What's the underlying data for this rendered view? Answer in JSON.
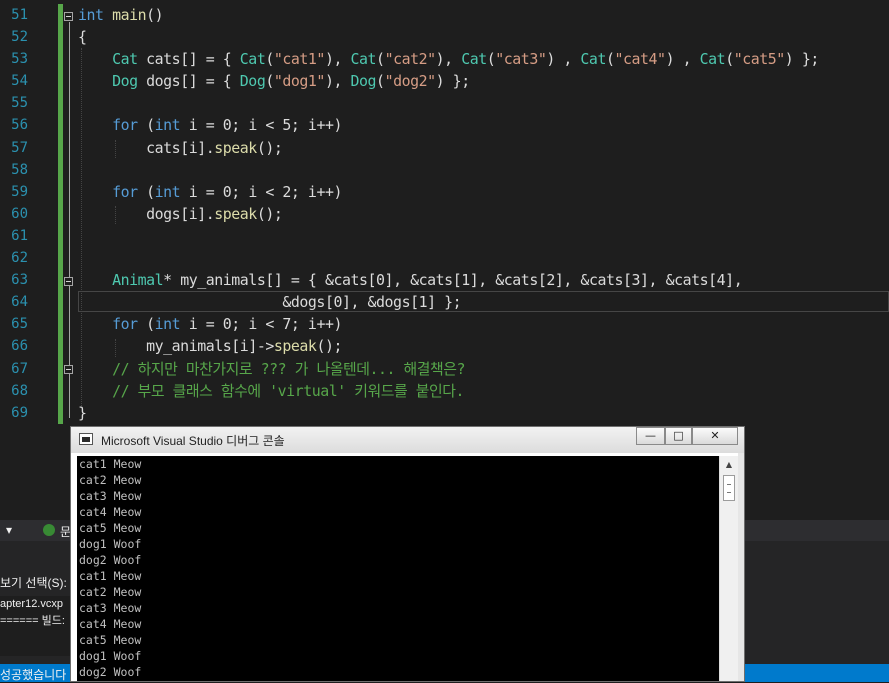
{
  "editor": {
    "line_numbers": [
      "51",
      "52",
      "53",
      "54",
      "55",
      "56",
      "57",
      "58",
      "59",
      "60",
      "61",
      "62",
      "63",
      "64",
      "65",
      "66",
      "67",
      "68",
      "69"
    ],
    "lines": [
      [
        {
          "t": "int",
          "c": "kw"
        },
        {
          "t": " ",
          "c": ""
        },
        {
          "t": "main",
          "c": "fn"
        },
        {
          "t": "()",
          "c": ""
        }
      ],
      [
        {
          "t": "{",
          "c": ""
        }
      ],
      [
        {
          "t": "    ",
          "c": ""
        },
        {
          "t": "Cat",
          "c": "ty"
        },
        {
          "t": " ",
          "c": ""
        },
        {
          "t": "cats",
          "c": "va"
        },
        {
          "t": "[] = { ",
          "c": ""
        },
        {
          "t": "Cat",
          "c": "ty"
        },
        {
          "t": "(",
          "c": ""
        },
        {
          "t": "\"cat1\"",
          "c": "st"
        },
        {
          "t": "), ",
          "c": ""
        },
        {
          "t": "Cat",
          "c": "ty"
        },
        {
          "t": "(",
          "c": ""
        },
        {
          "t": "\"cat2\"",
          "c": "st"
        },
        {
          "t": "), ",
          "c": ""
        },
        {
          "t": "Cat",
          "c": "ty"
        },
        {
          "t": "(",
          "c": ""
        },
        {
          "t": "\"cat3\"",
          "c": "st"
        },
        {
          "t": ") , ",
          "c": ""
        },
        {
          "t": "Cat",
          "c": "ty"
        },
        {
          "t": "(",
          "c": ""
        },
        {
          "t": "\"cat4\"",
          "c": "st"
        },
        {
          "t": ") , ",
          "c": ""
        },
        {
          "t": "Cat",
          "c": "ty"
        },
        {
          "t": "(",
          "c": ""
        },
        {
          "t": "\"cat5\"",
          "c": "st"
        },
        {
          "t": ") };",
          "c": ""
        }
      ],
      [
        {
          "t": "    ",
          "c": ""
        },
        {
          "t": "Dog",
          "c": "ty"
        },
        {
          "t": " ",
          "c": ""
        },
        {
          "t": "dogs",
          "c": "va"
        },
        {
          "t": "[] = { ",
          "c": ""
        },
        {
          "t": "Dog",
          "c": "ty"
        },
        {
          "t": "(",
          "c": ""
        },
        {
          "t": "\"dog1\"",
          "c": "st"
        },
        {
          "t": "), ",
          "c": ""
        },
        {
          "t": "Dog",
          "c": "ty"
        },
        {
          "t": "(",
          "c": ""
        },
        {
          "t": "\"dog2\"",
          "c": "st"
        },
        {
          "t": ") };",
          "c": ""
        }
      ],
      [],
      [
        {
          "t": "    ",
          "c": ""
        },
        {
          "t": "for",
          "c": "kw"
        },
        {
          "t": " (",
          "c": ""
        },
        {
          "t": "int",
          "c": "kw"
        },
        {
          "t": " ",
          "c": ""
        },
        {
          "t": "i",
          "c": "va"
        },
        {
          "t": " = 0; ",
          "c": ""
        },
        {
          "t": "i",
          "c": "va"
        },
        {
          "t": " < 5; ",
          "c": ""
        },
        {
          "t": "i",
          "c": "va"
        },
        {
          "t": "++)",
          "c": ""
        }
      ],
      [
        {
          "t": "        ",
          "c": ""
        },
        {
          "t": "cats",
          "c": "va"
        },
        {
          "t": "[",
          "c": ""
        },
        {
          "t": "i",
          "c": "va"
        },
        {
          "t": "].",
          "c": ""
        },
        {
          "t": "speak",
          "c": "fn"
        },
        {
          "t": "();",
          "c": ""
        }
      ],
      [],
      [
        {
          "t": "    ",
          "c": ""
        },
        {
          "t": "for",
          "c": "kw"
        },
        {
          "t": " (",
          "c": ""
        },
        {
          "t": "int",
          "c": "kw"
        },
        {
          "t": " ",
          "c": ""
        },
        {
          "t": "i",
          "c": "va"
        },
        {
          "t": " = 0; ",
          "c": ""
        },
        {
          "t": "i",
          "c": "va"
        },
        {
          "t": " < 2; ",
          "c": ""
        },
        {
          "t": "i",
          "c": "va"
        },
        {
          "t": "++)",
          "c": ""
        }
      ],
      [
        {
          "t": "        ",
          "c": ""
        },
        {
          "t": "dogs",
          "c": "va"
        },
        {
          "t": "[",
          "c": ""
        },
        {
          "t": "i",
          "c": "va"
        },
        {
          "t": "].",
          "c": ""
        },
        {
          "t": "speak",
          "c": "fn"
        },
        {
          "t": "();",
          "c": ""
        }
      ],
      [],
      [],
      [
        {
          "t": "    ",
          "c": ""
        },
        {
          "t": "Animal",
          "c": "ty"
        },
        {
          "t": "* ",
          "c": ""
        },
        {
          "t": "my_animals",
          "c": "va"
        },
        {
          "t": "[] = { &",
          "c": ""
        },
        {
          "t": "cats",
          "c": "va"
        },
        {
          "t": "[0], &",
          "c": ""
        },
        {
          "t": "cats",
          "c": "va"
        },
        {
          "t": "[1], &",
          "c": ""
        },
        {
          "t": "cats",
          "c": "va"
        },
        {
          "t": "[2], &",
          "c": ""
        },
        {
          "t": "cats",
          "c": "va"
        },
        {
          "t": "[3], &",
          "c": ""
        },
        {
          "t": "cats",
          "c": "va"
        },
        {
          "t": "[4],",
          "c": ""
        }
      ],
      [
        {
          "t": "                        &",
          "c": ""
        },
        {
          "t": "dogs",
          "c": "va"
        },
        {
          "t": "[0], &",
          "c": ""
        },
        {
          "t": "dogs",
          "c": "va"
        },
        {
          "t": "[1] };",
          "c": ""
        }
      ],
      [
        {
          "t": "    ",
          "c": ""
        },
        {
          "t": "for",
          "c": "kw"
        },
        {
          "t": " (",
          "c": ""
        },
        {
          "t": "int",
          "c": "kw"
        },
        {
          "t": " ",
          "c": ""
        },
        {
          "t": "i",
          "c": "va"
        },
        {
          "t": " = 0; ",
          "c": ""
        },
        {
          "t": "i",
          "c": "va"
        },
        {
          "t": " < 7; ",
          "c": ""
        },
        {
          "t": "i",
          "c": "va"
        },
        {
          "t": "++)",
          "c": ""
        }
      ],
      [
        {
          "t": "        ",
          "c": ""
        },
        {
          "t": "my_animals",
          "c": "va"
        },
        {
          "t": "[",
          "c": ""
        },
        {
          "t": "i",
          "c": "va"
        },
        {
          "t": "]->",
          "c": ""
        },
        {
          "t": "speak",
          "c": "fn"
        },
        {
          "t": "();",
          "c": ""
        }
      ],
      [
        {
          "t": "    ",
          "c": ""
        },
        {
          "t": "// 하지만 마찬가지로 ??? 가 나올텐데... 해결책은?",
          "c": "cm"
        }
      ],
      [
        {
          "t": "    ",
          "c": ""
        },
        {
          "t": "// 부모 클래스 함수에 'virtual' 키워드를 붙인다.",
          "c": "cm"
        }
      ],
      [
        {
          "t": "}",
          "c": ""
        }
      ]
    ]
  },
  "background_panels": {
    "toolbar_fragment": "▾",
    "badge_label": "문",
    "output_label_1": "보기 선택(S):",
    "output_line_1": "apter12.vcxp",
    "output_line_2": "====== 빌드:",
    "status_text": "성공했습니다"
  },
  "console": {
    "title": "Microsoft Visual Studio 디버그 콘솔",
    "buttons": {
      "minimize": "—",
      "maximize": "□",
      "close": "✕"
    },
    "scroll_up": "▲",
    "output_lines": [
      "cat1 Meow",
      "cat2 Meow",
      "cat3 Meow",
      "cat4 Meow",
      "cat5 Meow",
      "dog1 Woof",
      "dog2 Woof",
      "cat1 Meow",
      "cat2 Meow",
      "cat3 Meow",
      "cat4 Meow",
      "cat5 Meow",
      "dog1 Woof",
      "dog2 Woof"
    ]
  },
  "colors": {
    "editor_bg": "#1e1e1e",
    "keyword": "#569cd6",
    "type": "#4ec9b0",
    "string": "#d69d85",
    "comment": "#57a64a",
    "line_number": "#2b91af",
    "status_bar": "#007acc"
  }
}
